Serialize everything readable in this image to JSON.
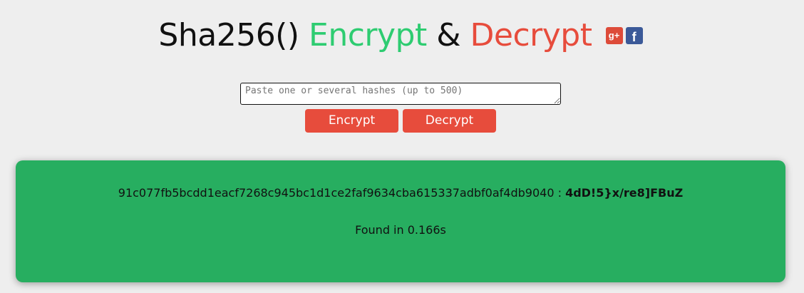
{
  "header": {
    "title_part1": "Sha256()",
    "title_part2": "Encrypt",
    "title_part3": "&",
    "title_part4": "Decrypt",
    "social": [
      {
        "icon": "google-plus-icon",
        "glyph": "g+",
        "color": "#dd4b39"
      },
      {
        "icon": "facebook-icon",
        "glyph": "f",
        "color": "#3b5998"
      }
    ]
  },
  "form": {
    "placeholder": "Paste one or several hashes (up to 500)",
    "value": "",
    "encrypt_label": "Encrypt",
    "decrypt_label": "Decrypt"
  },
  "result": {
    "hash": "91c077fb5bcdd1eacf7268c945bc1d1ce2faf9634cba615337adbf0af4db9040",
    "separator": " : ",
    "plaintext": "4dD!5}x/re8]FBuZ",
    "found_text": "Found in 0.166s"
  },
  "colors": {
    "background": "#eeeeee",
    "encrypt_green": "#2ecc71",
    "decrypt_red": "#e74c3c",
    "result_green": "#27ae60"
  }
}
